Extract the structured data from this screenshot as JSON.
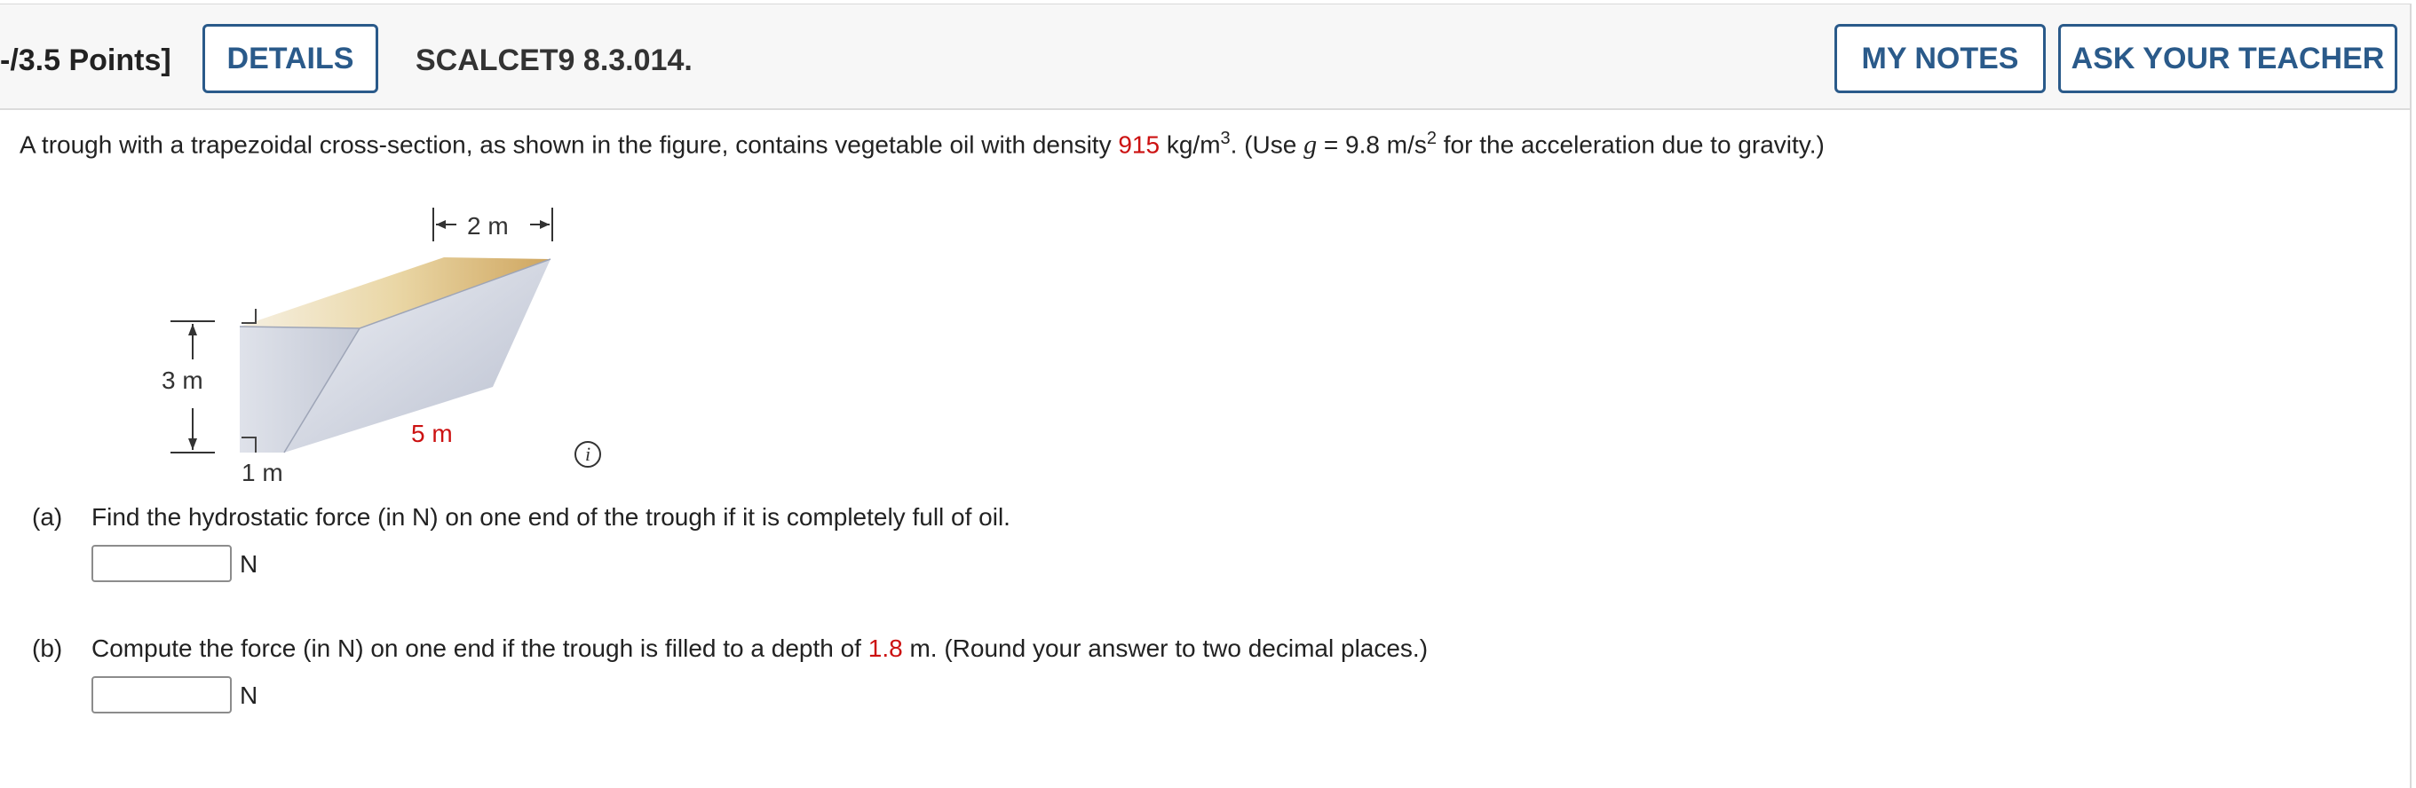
{
  "header": {
    "points": "-/3.5 Points]",
    "details_label": "DETAILS",
    "question_id": "SCALCET9 8.3.014.",
    "my_notes_label": "MY NOTES",
    "ask_teacher_label": "ASK YOUR TEACHER"
  },
  "problem": {
    "intro_part1": "A trough with a trapezoidal cross-section, as shown in the figure, contains vegetable oil with density ",
    "density": "915",
    "intro_part2": " kg/m",
    "exp3": "3",
    "intro_part3": ". (Use ",
    "g_symbol": "g",
    "intro_part4": " = 9.8 m/s",
    "exp2": "2",
    "intro_part5": " for the acceleration due to gravity.)"
  },
  "figure": {
    "top_width": "2 m",
    "height": "3 m",
    "length": "5 m",
    "bottom_width": "1 m",
    "info_glyph": "i"
  },
  "part_a": {
    "label": "(a)",
    "text": "Find the hydrostatic force (in N) on one end of the trough if it is completely full of oil.",
    "unit": "N",
    "value": ""
  },
  "part_b": {
    "label": "(b)",
    "text_before": "Compute the force (in N) on one end if the trough is filled to a depth of ",
    "depth": "1.8",
    "text_after": " m. (Round your answer to two decimal places.)",
    "unit": "N",
    "value": ""
  }
}
